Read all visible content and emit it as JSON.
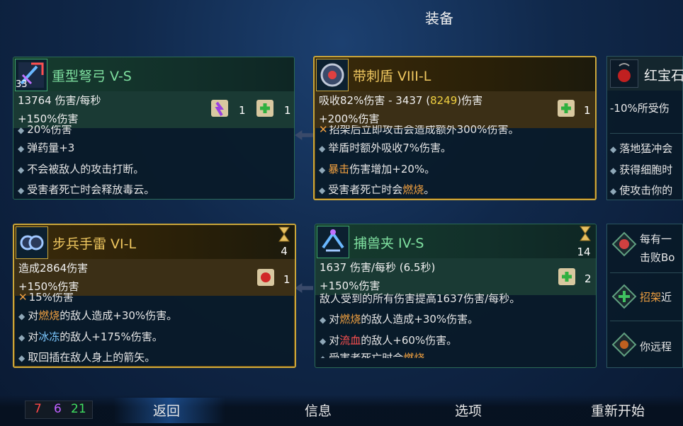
{
  "title": "装备",
  "cards": [
    {
      "name": "重型弩弓 V-S",
      "stat1": "13764 伤害/每秒",
      "stat2": "+150%伤害",
      "icon_count": "33",
      "scroll1_count": "1",
      "scroll2_count": "1",
      "lines": [
        "20%伤害",
        "弹药量+3",
        "不会被敌人的攻击打断。",
        "受害者死亡时会释放毒云。"
      ]
    },
    {
      "name": "带刺盾 VIII-L",
      "stat1_a": "吸收82%伤害 - 3437 (",
      "stat1_b": "8249",
      "stat1_c": ")伤害",
      "stat2": "+200%伤害",
      "scroll_count": "1",
      "line0": "招架后立即攻击会造成额外300%伤害。",
      "line1": "举盾时额外吸收7%伤害。",
      "line2_a": "暴击",
      "line2_b": "伤害增加+20%。",
      "line3_a": "受害者死亡时会",
      "line3_b": "燃烧",
      "line3_c": "。"
    },
    {
      "name": "步兵手雷 VI-L",
      "stat1": "造成2864伤害",
      "stat2": "+150%伤害",
      "timer": "4",
      "scroll_count": "1",
      "line0": "15%伤害",
      "line1_a": "对",
      "line1_b": "燃烧",
      "line1_c": "的敌人造成+30%伤害。",
      "line2_a": "对",
      "line2_b": "冰冻",
      "line2_c": "的敌人+175%伤害。",
      "line3": "取回插在敌人身上的箭矢。"
    },
    {
      "name": "捕兽夹 IV-S",
      "stat1": "1637 伤害/每秒 (6.5秒)",
      "stat2": "+150%伤害",
      "timer": "14",
      "scroll_count": "2",
      "line0": "敌人受到的所有伤害提高1637伤害/每秒。",
      "line1_a": "对",
      "line1_b": "燃烧",
      "line1_c": "的敌人造成+30%伤害。",
      "line2_a": "对",
      "line2_b": "流血",
      "line2_c": "的敌人+60%伤害。",
      "line3_a": "受害者死亡时会",
      "line3_b": "燃烧"
    }
  ],
  "right_top": {
    "name": "红宝石",
    "stat": "-10%所受伤",
    "lines": [
      "落地猛冲会",
      "获得细胞时",
      "使攻击你的"
    ]
  },
  "right_bottom": {
    "line1": "每有一",
    "line1b": "击败Bo",
    "line2_a": "招架",
    "line2_b": "近",
    "line3": "你远程"
  },
  "scores": {
    "red": "7",
    "purple": "6",
    "green": "21"
  },
  "nav": {
    "back": "返回",
    "info": "信息",
    "options": "选项",
    "restart": "重新开始"
  },
  "colors": {
    "gold_border": "#caa63a",
    "green_border": "#2b6a55",
    "highlight_blue": "#2a6ec8"
  }
}
